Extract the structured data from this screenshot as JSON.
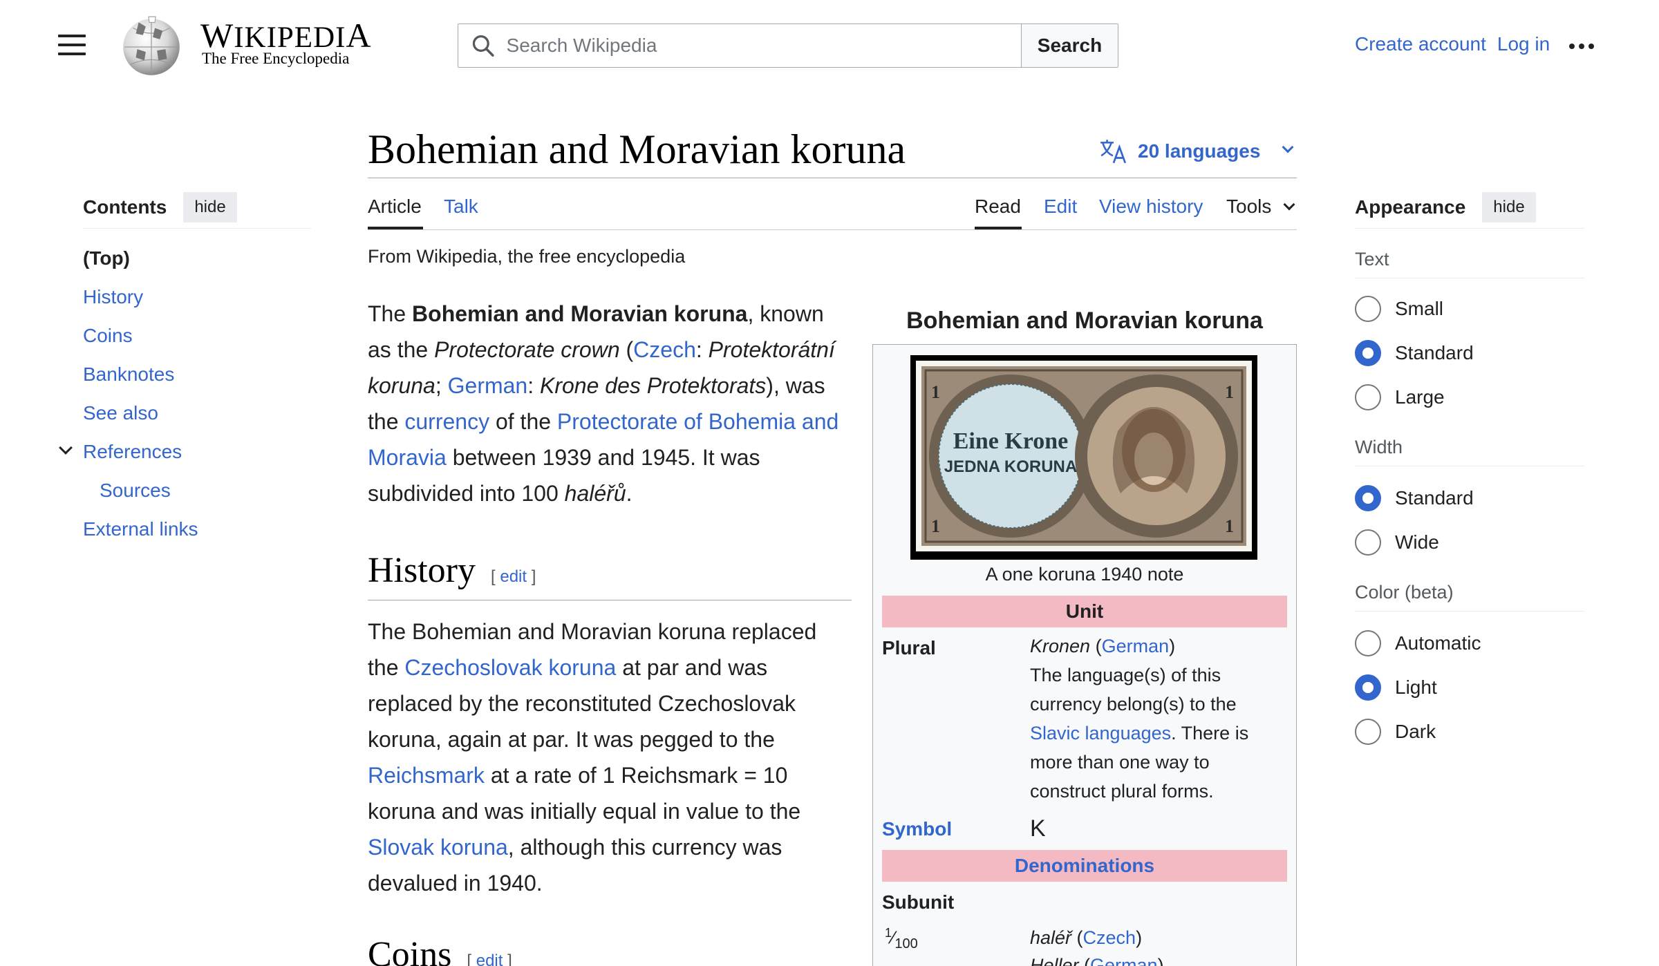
{
  "header": {
    "wordmark_first": "W",
    "wordmark_rest": "IKIPEDI",
    "wordmark_last": "A",
    "tagline": "The Free Encyclopedia",
    "search_placeholder": "Search Wikipedia",
    "search_button": "Search",
    "create_account": "Create account",
    "log_in": "Log in"
  },
  "article": {
    "title": "Bohemian and Moravian koruna",
    "languages": "20 languages",
    "tabs": {
      "article": "Article",
      "talk": "Talk",
      "read": "Read",
      "edit": "Edit",
      "history": "View history",
      "tools": "Tools"
    },
    "from_wiki": "From Wikipedia, the free encyclopedia",
    "lead": {
      "t1": "The ",
      "bold": "Bohemian and Moravian koruna",
      "t2": ", known as the ",
      "it1": "Protectorate crown",
      "t3": " (",
      "l_czech": "Czech",
      "t4": ": ",
      "it2": "Protektorátní koruna",
      "t5": "; ",
      "l_german": "German",
      "t6": ": ",
      "it3": "Krone des Protektorats",
      "t7": "), was the ",
      "l_currency": "currency",
      "t8": " of the ",
      "l_protectorate": "Protectorate of Bohemia and Moravia",
      "t9": " between 1939 and 1945. It was subdivided into 100 ",
      "it4": "haléřů",
      "t10": "."
    },
    "history": {
      "heading": "History",
      "edit": "edit",
      "t1": "The Bohemian and Moravian koruna replaced the ",
      "l_czechoslovak": "Czechoslovak koruna",
      "t2": " at par and was replaced by the reconstituted Czechoslovak koruna, again at par. It was pegged to the ",
      "l_reichsmark": "Reichsmark",
      "t3": " at a rate of 1 Reichsmark = 10 koruna and was initially equal in value to the ",
      "l_slovak": "Slovak koruna",
      "t4": ", although this currency was devalued in 1940."
    },
    "coins": {
      "heading": "Coins",
      "edit": "edit"
    }
  },
  "toc": {
    "title": "Contents",
    "hide": "hide",
    "items": [
      "(Top)",
      "History",
      "Coins",
      "Banknotes",
      "See also",
      "References",
      "Sources",
      "External links"
    ]
  },
  "appearance": {
    "title": "Appearance",
    "hide": "hide",
    "text_label": "Text",
    "text_options": [
      "Small",
      "Standard",
      "Large"
    ],
    "text_selected": "Standard",
    "width_label": "Width",
    "width_options": [
      "Standard",
      "Wide"
    ],
    "width_selected": "Standard",
    "color_label": "Color (beta)",
    "color_options": [
      "Automatic",
      "Light",
      "Dark"
    ],
    "color_selected": "Light"
  },
  "infobox": {
    "title": "Bohemian and Moravian koruna",
    "note_text_1": "Eine Krone",
    "note_text_2": "JEDNA KORUNA",
    "caption": "A one koruna 1940 note",
    "unit_band": "Unit",
    "plural_label": "Plural",
    "plural_word": "Kronen",
    "plural_open": " (",
    "plural_link": "German",
    "plural_close": ")",
    "plural_note_1": "The language(s) of this currency belong(s) to the ",
    "plural_note_link": "Slavic languages",
    "plural_note_2": ". There is more than one way to construct plural forms.",
    "symbol_label": "Symbol",
    "symbol_value": "K",
    "denominations_band": "Denominations",
    "subunit_label": "Subunit",
    "fraction_num": "1",
    "fraction_den": "100",
    "sub_word_1": "haléř",
    "sub_link_1": "Czech",
    "sub_word_2": "Heller",
    "sub_link_2": "German"
  },
  "colors": {
    "link": "#3366cc",
    "band": "#f4bac4",
    "progressive": "#3366cc"
  }
}
